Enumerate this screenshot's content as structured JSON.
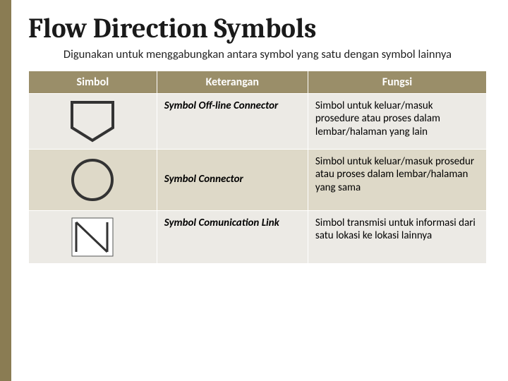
{
  "title": "Flow Direction Symbols",
  "subtitle": "Digunakan untuk menggabungkan antara symbol yang satu dengan symbol lainnya",
  "headers": {
    "col1": "Simbol",
    "col2": "Keterangan",
    "col3": "Fungsi"
  },
  "rows": [
    {
      "icon": "offpage-connector-icon",
      "keterangan": "Symbol Off-line Connector",
      "fungsi": "Simbol untuk keluar/masuk prosedure atau proses dalam lembar/halaman yang lain"
    },
    {
      "icon": "connector-circle-icon",
      "keterangan": "Symbol Connector",
      "fungsi": "Simbol untuk keluar/masuk prosedur atau proses dalam lembar/halaman yang sama"
    },
    {
      "icon": "communication-link-icon",
      "keterangan": "Symbol Comunication Link",
      "fungsi": "Simbol transmisi untuk informasi dari satu lokasi ke lokasi lainnya"
    }
  ]
}
